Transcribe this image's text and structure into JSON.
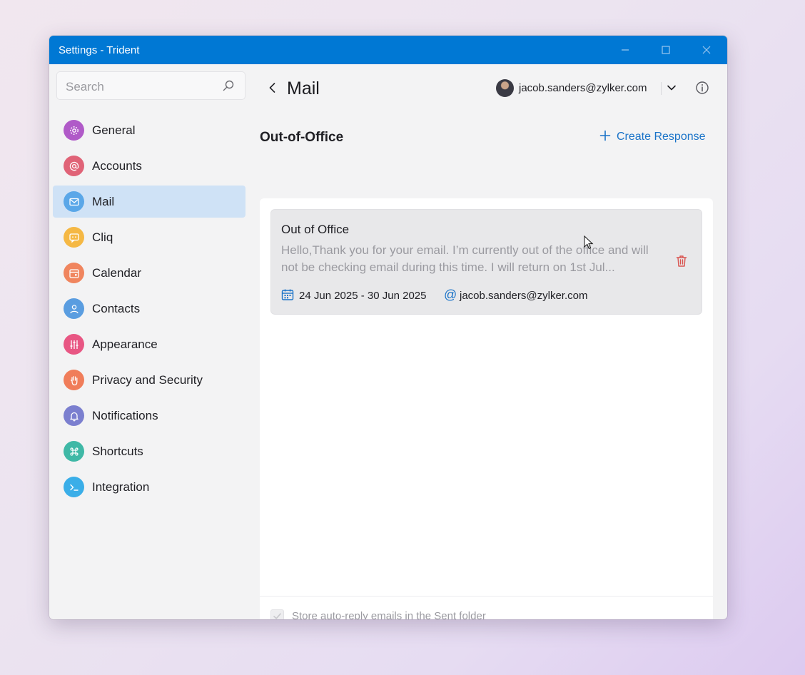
{
  "window": {
    "title": "Settings - Trident"
  },
  "sidebar": {
    "search_placeholder": "Search",
    "items": [
      {
        "label": "General",
        "icon": "gear-icon",
        "color": "#b05ac8"
      },
      {
        "label": "Accounts",
        "icon": "at-icon",
        "color": "#e06377"
      },
      {
        "label": "Mail",
        "icon": "mail-icon",
        "color": "#5aa7e8",
        "active": true
      },
      {
        "label": "Cliq",
        "icon": "chat-icon",
        "color": "#f5b844"
      },
      {
        "label": "Calendar",
        "icon": "calendar-icon",
        "color": "#f0855e"
      },
      {
        "label": "Contacts",
        "icon": "person-icon",
        "color": "#5a9de0"
      },
      {
        "label": "Appearance",
        "icon": "sliders-icon",
        "color": "#e85683"
      },
      {
        "label": "Privacy and Security",
        "icon": "hand-icon",
        "color": "#f07d5a"
      },
      {
        "label": "Notifications",
        "icon": "bell-icon",
        "color": "#7b7fcf"
      },
      {
        "label": "Shortcuts",
        "icon": "command-icon",
        "color": "#3fb8a6"
      },
      {
        "label": "Integration",
        "icon": "terminal-icon",
        "color": "#3aaee8"
      }
    ]
  },
  "header": {
    "title": "Mail",
    "account_email": "jacob.sanders@zylker.com"
  },
  "section": {
    "title": "Out-of-Office",
    "create_label": "Create Response"
  },
  "response": {
    "title": "Out of Office",
    "body": "Hello,Thank you for your email. I’m currently out of the office and will not be checking email during this time. I will return on 1st Jul...",
    "dates": "24 Jun 2025 - 30 Jun 2025",
    "email": "jacob.sanders@zylker.com"
  },
  "footer": {
    "checkbox_label": "Store auto-reply emails in the Sent folder",
    "checked": true
  },
  "colors": {
    "accent": "#0078d4",
    "link": "#1a73c8",
    "delete": "#d9534f"
  }
}
